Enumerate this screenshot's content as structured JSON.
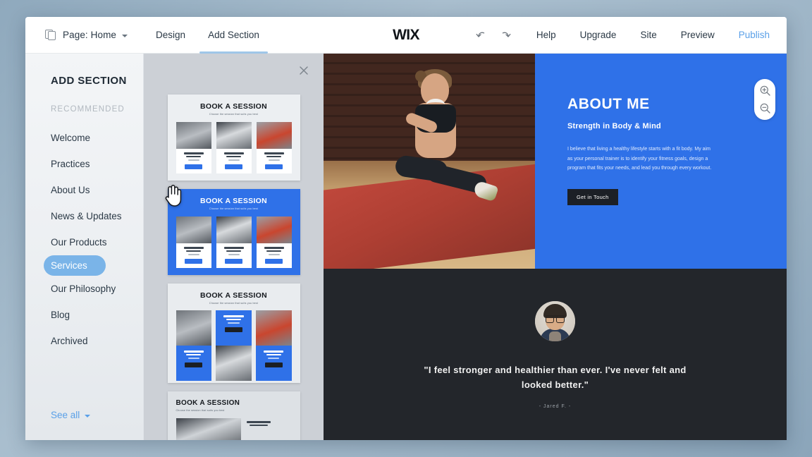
{
  "topbar": {
    "pages_icon": "pages-icon",
    "page_label": "Page: Home",
    "tabs": [
      {
        "label": "Design",
        "active": false
      },
      {
        "label": "Add Section",
        "active": true
      }
    ],
    "logo": "WIX",
    "undo_icon": "undo-arrow-icon",
    "redo_icon": "redo-arrow-icon",
    "links": [
      {
        "label": "Help"
      },
      {
        "label": "Upgrade"
      },
      {
        "label": "Site"
      },
      {
        "label": "Preview"
      }
    ],
    "publish_label": "Publish",
    "publish_color": "#5aa0e8"
  },
  "sidebar": {
    "title": "ADD SECTION",
    "subtitle": "RECOMMENDED",
    "items": [
      {
        "label": "Welcome",
        "selected": false
      },
      {
        "label": "Practices",
        "selected": false
      },
      {
        "label": "About Us",
        "selected": false
      },
      {
        "label": "News & Updates",
        "selected": false
      },
      {
        "label": "Our Products",
        "selected": false
      },
      {
        "label": "Services",
        "selected": true
      },
      {
        "label": "Our Philosophy",
        "selected": false
      },
      {
        "label": "Blog",
        "selected": false
      },
      {
        "label": "Archived",
        "selected": false
      }
    ],
    "see_all_label": "See all",
    "selected_bg": "#7ab4e8"
  },
  "thumbpanel": {
    "close_icon": "close-icon",
    "cursor_icon": "hand-pointer-cursor",
    "thumbnails": [
      {
        "title": "BOOK A SESSION",
        "subtitle": "Choose the session that suits you best",
        "selected": false,
        "cards": [
          "PERSONAL TRAINING",
          "SPORT TRAINING",
          "PHYSICAL THERAPY"
        ],
        "button_label": "Book Now"
      },
      {
        "title": "BOOK A SESSION",
        "subtitle": "Choose the session that suits you best",
        "selected": true,
        "cards": [
          "PERSONAL TRAINING",
          "SPORT TRAINING",
          "PHYSICAL THERAPY"
        ],
        "button_label": "Book Now"
      },
      {
        "title": "BOOK A SESSION",
        "subtitle": "Choose the session that suits you best",
        "selected": false,
        "cards": [
          "PERSONAL TRAINING",
          "SPORT TRAINING",
          "PHYSICAL THERAPY"
        ],
        "button_label": "Book Now"
      },
      {
        "title": "BOOK A SESSION",
        "subtitle": "Choose the session that suits you best",
        "selected": false,
        "cards": [
          "PERSONAL TRAINING"
        ],
        "button_label": "Book Now"
      }
    ]
  },
  "canvas": {
    "hero": {
      "image_alt": "Woman stretching on a red gym mat",
      "heading": "ABOUT ME",
      "subheading": "Strength in Body & Mind",
      "paragraph": "I believe that living a healthy lifestyle starts with a fit body. My aim as your personal trainer is to identify your fitness goals, design a program that fits your needs, and lead you through every workout.",
      "button_label": "Get in Touch",
      "bg_color": "#2f71e8",
      "button_color": "#1c2026"
    },
    "testimonial": {
      "avatar_alt": "Portrait of a man with glasses",
      "quote": "\"I feel stronger and healthier than ever. I've never felt and looked better.\"",
      "attribution": "- Jared F. -",
      "bg_color": "#23262b"
    },
    "zoom_in_icon": "zoom-in-icon",
    "zoom_out_icon": "zoom-out-icon"
  }
}
